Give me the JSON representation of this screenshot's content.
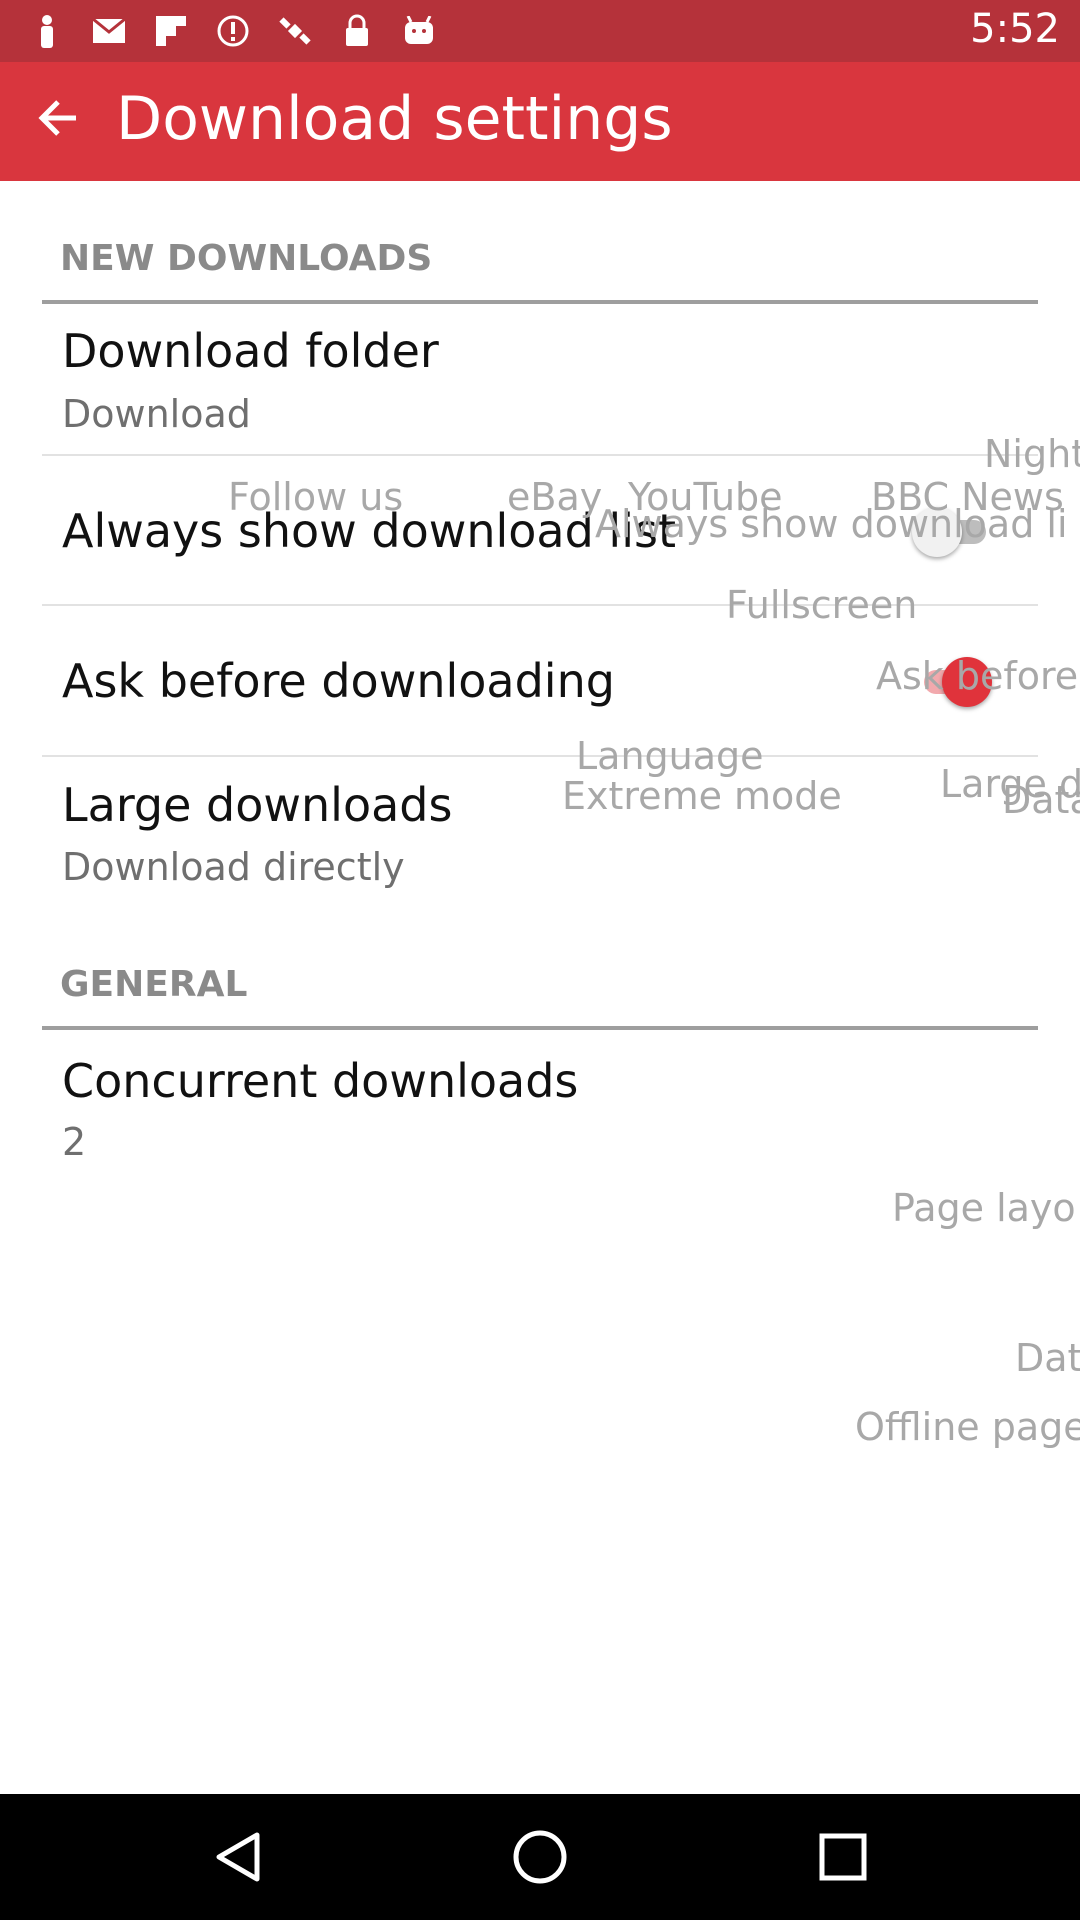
{
  "status_bar": {
    "time": "5:52",
    "icons": [
      "person-icon",
      "mail-icon",
      "flipboard-icon",
      "alert-icon",
      "satellite-icon",
      "lock-icon",
      "android-icon"
    ]
  },
  "app_bar": {
    "title": "Download settings",
    "back_icon": "arrow-left-icon"
  },
  "sections": {
    "new_downloads": "NEW DOWNLOADS",
    "general": "GENERAL"
  },
  "settings": {
    "download_folder": {
      "title": "Download folder",
      "subtitle": "Download"
    },
    "always_show_list": {
      "title": "Always show download list",
      "enabled": false
    },
    "ask_before": {
      "title": "Ask before downloading",
      "enabled": true
    },
    "large_downloads": {
      "title": "Large downloads",
      "subtitle": "Download directly"
    },
    "concurrent": {
      "title": "Concurrent downloads",
      "subtitle": "2"
    }
  },
  "overlay_text": {
    "night": "Night",
    "follow_us": "Follow us",
    "ebay": "eBay",
    "youtube": "YouTube",
    "bbc_news": "BBC News",
    "always_show_partial": "Always show download li",
    "fullscreen": "Fullscreen",
    "ask_before_partial": "Ask before",
    "language": "Language",
    "extreme_mode": "Extreme mode",
    "large_partial": "Large d",
    "data_partial": "Data",
    "page_layout_partial": "Page layo",
    "dat_partial": "Dat",
    "offline_partial": "Offline page"
  },
  "colors": {
    "status_bar": "#b5323a",
    "app_bar": "#d9363e",
    "accent": "#e0333b",
    "switch_off_track": "#bdbdbd",
    "switch_off_thumb": "#f1f1f1"
  },
  "nav_bar": {
    "back": "back-triangle-icon",
    "home": "home-circle-icon",
    "recents": "recents-square-icon"
  }
}
